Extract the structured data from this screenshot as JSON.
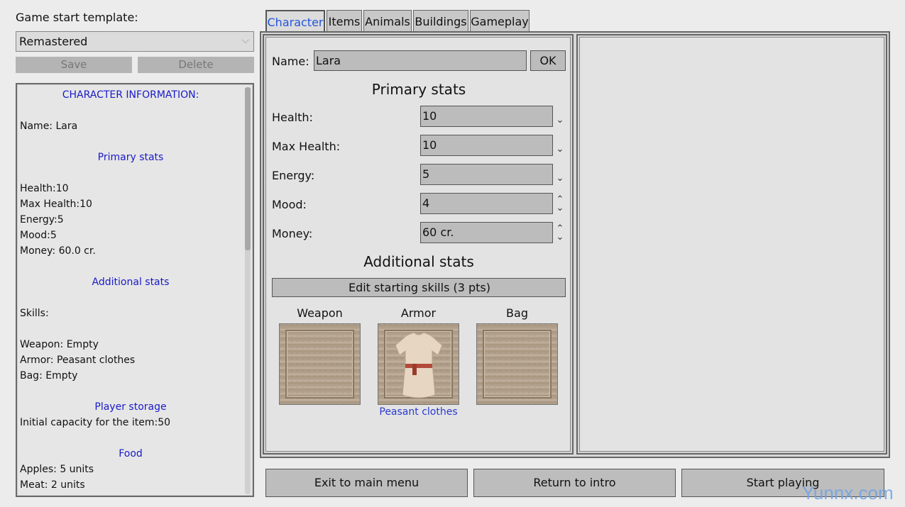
{
  "template": {
    "label": "Game start template:",
    "selected": "Remastered",
    "save_label": "Save",
    "delete_label": "Delete"
  },
  "info": {
    "lines": [
      {
        "text": "CHARACTER INFORMATION:",
        "head": true
      },
      {
        "text": "",
        "head": false
      },
      {
        "text": "Name: Lara",
        "head": false
      },
      {
        "text": "",
        "head": false
      },
      {
        "text": "Primary stats",
        "head": true
      },
      {
        "text": "",
        "head": false
      },
      {
        "text": "Health:10",
        "head": false
      },
      {
        "text": "Max Health:10",
        "head": false
      },
      {
        "text": "Energy:5",
        "head": false
      },
      {
        "text": "Mood:5",
        "head": false
      },
      {
        "text": "Money: 60.0 cr.",
        "head": false
      },
      {
        "text": "",
        "head": false
      },
      {
        "text": "Additional stats",
        "head": true
      },
      {
        "text": "",
        "head": false
      },
      {
        "text": "Skills:",
        "head": false
      },
      {
        "text": "",
        "head": false
      },
      {
        "text": "Weapon: Empty",
        "head": false
      },
      {
        "text": "Armor: Peasant clothes",
        "head": false
      },
      {
        "text": "Bag: Empty",
        "head": false
      },
      {
        "text": "",
        "head": false
      },
      {
        "text": "Player storage",
        "head": true
      },
      {
        "text": "Initial capacity for the item:50",
        "head": false
      },
      {
        "text": "",
        "head": false
      },
      {
        "text": "Food",
        "head": true
      },
      {
        "text": "Apples: 5 units",
        "head": false
      },
      {
        "text": "Meat: 2 units",
        "head": false
      }
    ]
  },
  "tabs": [
    "Character",
    "Items",
    "Animals",
    "Buildings",
    "Gameplay"
  ],
  "character": {
    "name_label": "Name:",
    "name_value": "Lara",
    "ok_label": "OK",
    "primary_title": "Primary stats",
    "stats": [
      {
        "label": "Health:",
        "value": "10",
        "up": false
      },
      {
        "label": "Max Health:",
        "value": "10",
        "up": false
      },
      {
        "label": "Energy:",
        "value": "5",
        "up": false
      },
      {
        "label": "Mood:",
        "value": "4",
        "up": true
      },
      {
        "label": "Money:",
        "value": "60 cr.",
        "up": true
      }
    ],
    "additional_title": "Additional stats",
    "skills_button": "Edit starting skills (3 pts)",
    "slots": [
      {
        "title": "Weapon",
        "item": ""
      },
      {
        "title": "Armor",
        "item": "Peasant clothes"
      },
      {
        "title": "Bag",
        "item": ""
      }
    ]
  },
  "bottom": {
    "exit": "Exit to main menu",
    "intro": "Return to intro",
    "start": "Start playing"
  },
  "watermark": "Yunnx.com"
}
